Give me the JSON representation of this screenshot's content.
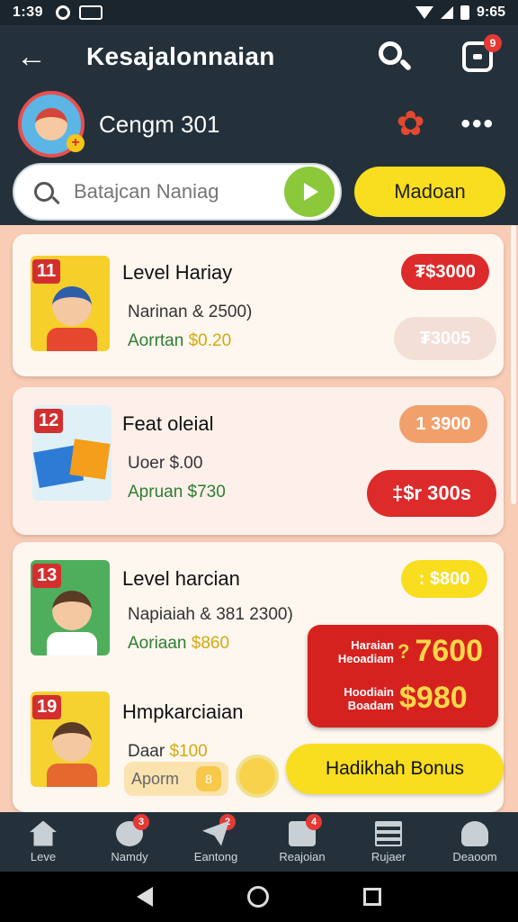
{
  "status_bar": {
    "time": "1:39",
    "battery_text": "9:65"
  },
  "header": {
    "title": "Kesajalonnaian",
    "scan_badge": "9"
  },
  "profile": {
    "username": "Cengm 301"
  },
  "search": {
    "placeholder": "Batajcan Naniag"
  },
  "primary_button": {
    "label": "Madoan"
  },
  "cards": [
    {
      "level": "11",
      "title": "Level Hariay",
      "sub": "Narinan & 2500)",
      "amount_prefix": "Aorrtan ",
      "amount_value": "$0.20",
      "pill_top": "₮$3000",
      "pill_bottom": "₮3005"
    },
    {
      "level": "12",
      "title": "Feat oleial",
      "sub": "Uoer $.00",
      "amount": "Apruan $730",
      "pill_top": "1 3900",
      "pill_bottom": "‡$r 300s"
    },
    {
      "level": "13",
      "title": "Level harcian",
      "sub": "Napiaiah & 381 2300)",
      "amount_prefix": "Aoriaan ",
      "amount_value": "$860",
      "pill_top": ": $800"
    },
    {
      "level": "19",
      "title": "Hmpkarciaian",
      "sub_prefix": "Daar ",
      "sub_value": "$100",
      "apply_label": "Aporm",
      "apply_mini": "8"
    }
  ],
  "promo": {
    "row1_label": "Haraian Heoadiam",
    "row1_value": "7600",
    "row1_mark": "?",
    "row2_label": "Hoodiain Boadam",
    "row2_value": "$980"
  },
  "bonus_button": {
    "label": "Hadikhah Bonus"
  },
  "bottom_nav": [
    {
      "label": "Leve",
      "icon": "home-icon",
      "badge": ""
    },
    {
      "label": "Namdy",
      "icon": "face-icon",
      "badge": "3"
    },
    {
      "label": "Eantong",
      "icon": "send-icon",
      "badge": "2"
    },
    {
      "label": "Reajoian",
      "icon": "search-list-icon",
      "badge": "4"
    },
    {
      "label": "Rujaer",
      "icon": "list-icon",
      "badge": ""
    },
    {
      "label": "Deaoom",
      "icon": "user-icon",
      "badge": ""
    }
  ],
  "colors": {
    "accent_yellow": "#f8de1f",
    "accent_red": "#dd2a2a",
    "header_bg": "#24313b",
    "content_bg": "#f9ccb6",
    "go_green": "#8bc83a"
  }
}
